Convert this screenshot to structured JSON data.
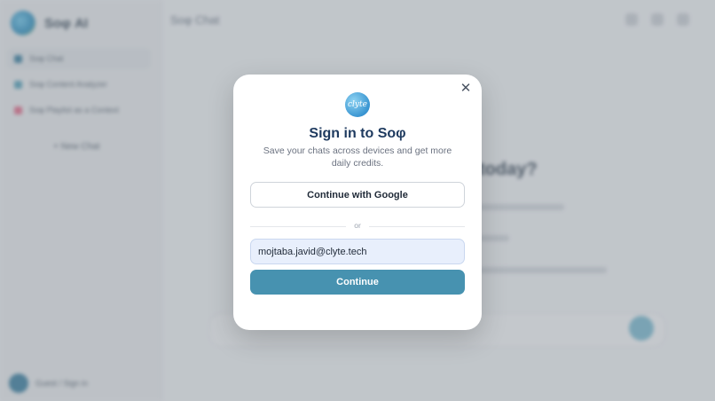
{
  "app": {
    "brand_name": "Soφ AI",
    "page_title": "Soφ Chat",
    "sidebar_items": [
      {
        "label": "Soφ Chat",
        "color": "#3c7fa0"
      },
      {
        "label": "Soφ Content Analyzer",
        "color": "#57a0b8"
      },
      {
        "label": "Soφ Playlist as a Context",
        "color": "#e06d8a"
      }
    ],
    "new_chat_label": "+ New Chat",
    "user_name": "Guest / Sign in",
    "welcome_heading": "today?"
  },
  "modal": {
    "logo_text": "clyte",
    "title": "Sign in to Soφ",
    "subtitle": "Save your chats across devices and get more daily credits.",
    "google_button_label": "Continue with Google",
    "divider_text": "or",
    "email_value": "mojtaba.javid@clyte.tech",
    "continue_button_label": "Continue",
    "close_icon": "close-icon",
    "accent_color": "#4792b0"
  }
}
